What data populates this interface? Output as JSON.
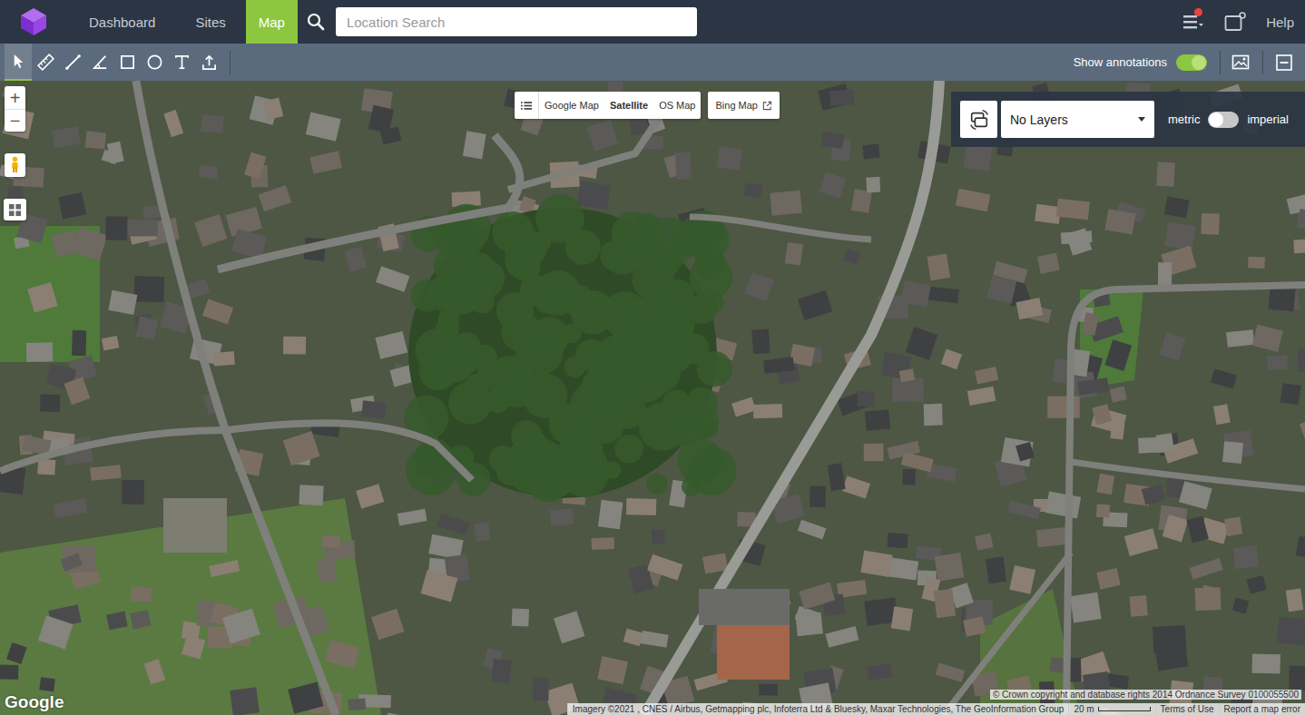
{
  "nav": {
    "items": [
      {
        "label": "Dashboard",
        "selected": false
      },
      {
        "label": "Sites",
        "selected": false
      },
      {
        "label": "Map",
        "selected": true
      }
    ],
    "search": {
      "placeholder": "Location Search"
    },
    "has_notifications": true,
    "help": "Help"
  },
  "toolbar": {
    "tools": [
      {
        "kind": "select",
        "selected": true
      },
      {
        "kind": "measure",
        "selected": false
      },
      {
        "kind": "line",
        "selected": false
      },
      {
        "kind": "angle",
        "selected": false
      },
      {
        "kind": "rectangle",
        "selected": false
      },
      {
        "kind": "circle",
        "selected": false
      },
      {
        "kind": "text",
        "selected": false
      },
      {
        "kind": "upload",
        "selected": false
      }
    ],
    "annotations": {
      "label": "Show annotations",
      "on": true
    }
  },
  "map_types": [
    {
      "label": "Google Map",
      "selected": false
    },
    {
      "label": "Satellite",
      "selected": true
    },
    {
      "label": "OS Map",
      "selected": false
    }
  ],
  "bing": {
    "label": "Bing Map"
  },
  "layers": {
    "value": "No Layers"
  },
  "units": {
    "metric": "metric",
    "imperial": "imperial",
    "imperial_on": false
  },
  "zoom": {
    "in": "+",
    "out": "−"
  },
  "attribution": {
    "logo": "Google",
    "crown": "© Crown copyright and database rights 2014 Ordnance Survey 0100055500",
    "imagery": "Imagery ©2021 , CNES / Airbus, Getmapping plc, Infoterra Ltd & Bluesky, Maxar Technologies, The GeoInformation Group",
    "scale": "20 m",
    "terms": "Terms of Use",
    "report": "Report a map error"
  }
}
